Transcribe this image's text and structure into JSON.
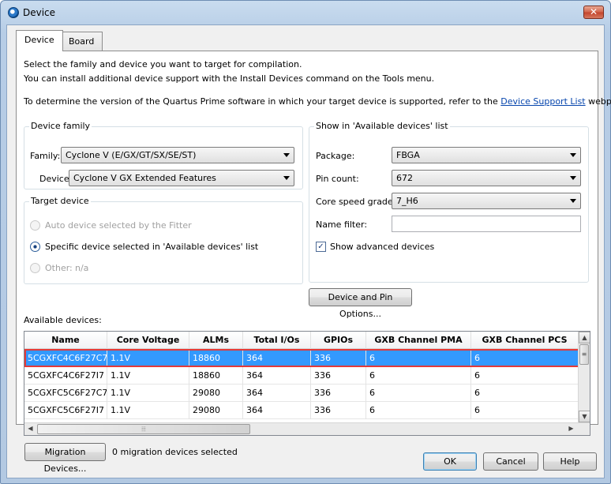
{
  "window": {
    "title": "Device"
  },
  "tabs": [
    {
      "label": "Device"
    },
    {
      "label": "Board"
    }
  ],
  "intro": {
    "line1": "Select the family and device you want to target for compilation.",
    "line2": "You can install additional device support with the Install Devices command on the Tools menu.",
    "line3_prefix": "To determine the version of the Quartus Prime software in which your target device is supported, refer to the",
    "line3_link": "Device Support List",
    "line3_suffix": "webpage."
  },
  "device_family": {
    "group_label": "Device family",
    "family_label": "Family:",
    "family_value": "Cyclone V (E/GX/GT/SX/SE/ST)",
    "device_label": "Device:",
    "device_value": "Cyclone V GX Extended Features"
  },
  "target_device": {
    "group_label": "Target device",
    "auto_label": "Auto device selected by the Fitter",
    "specific_label": "Specific device selected in 'Available devices' list",
    "other_label": "Other:",
    "other_value": "n/a"
  },
  "show_list": {
    "group_label": "Show in 'Available devices' list",
    "package_label": "Package:",
    "package_value": "FBGA",
    "pincount_label": "Pin count:",
    "pincount_value": "672",
    "speed_label": "Core speed grade:",
    "speed_value": "7_H6",
    "namefilter_label": "Name filter:",
    "namefilter_value": "",
    "advanced_label": "Show advanced devices"
  },
  "device_pin_button": "Device and Pin Options...",
  "available_label": "Available devices:",
  "table": {
    "headers": [
      "Name",
      "Core Voltage",
      "ALMs",
      "Total I/Os",
      "GPIOs",
      "GXB Channel PMA",
      "GXB Channel PCS"
    ],
    "rows": [
      [
        "5CGXFC4C6F27C7",
        "1.1V",
        "18860",
        "364",
        "336",
        "6",
        "6"
      ],
      [
        "5CGXFC4C6F27I7",
        "1.1V",
        "18860",
        "364",
        "336",
        "6",
        "6"
      ],
      [
        "5CGXFC5C6F27C7",
        "1.1V",
        "29080",
        "364",
        "336",
        "6",
        "6"
      ],
      [
        "5CGXFC5C6F27I7",
        "1.1V",
        "29080",
        "364",
        "336",
        "6",
        "6"
      ]
    ]
  },
  "migration": {
    "button": "Migration Devices...",
    "status": "0 migration devices selected"
  },
  "footer": {
    "ok": "OK",
    "cancel": "Cancel",
    "help": "Help"
  }
}
